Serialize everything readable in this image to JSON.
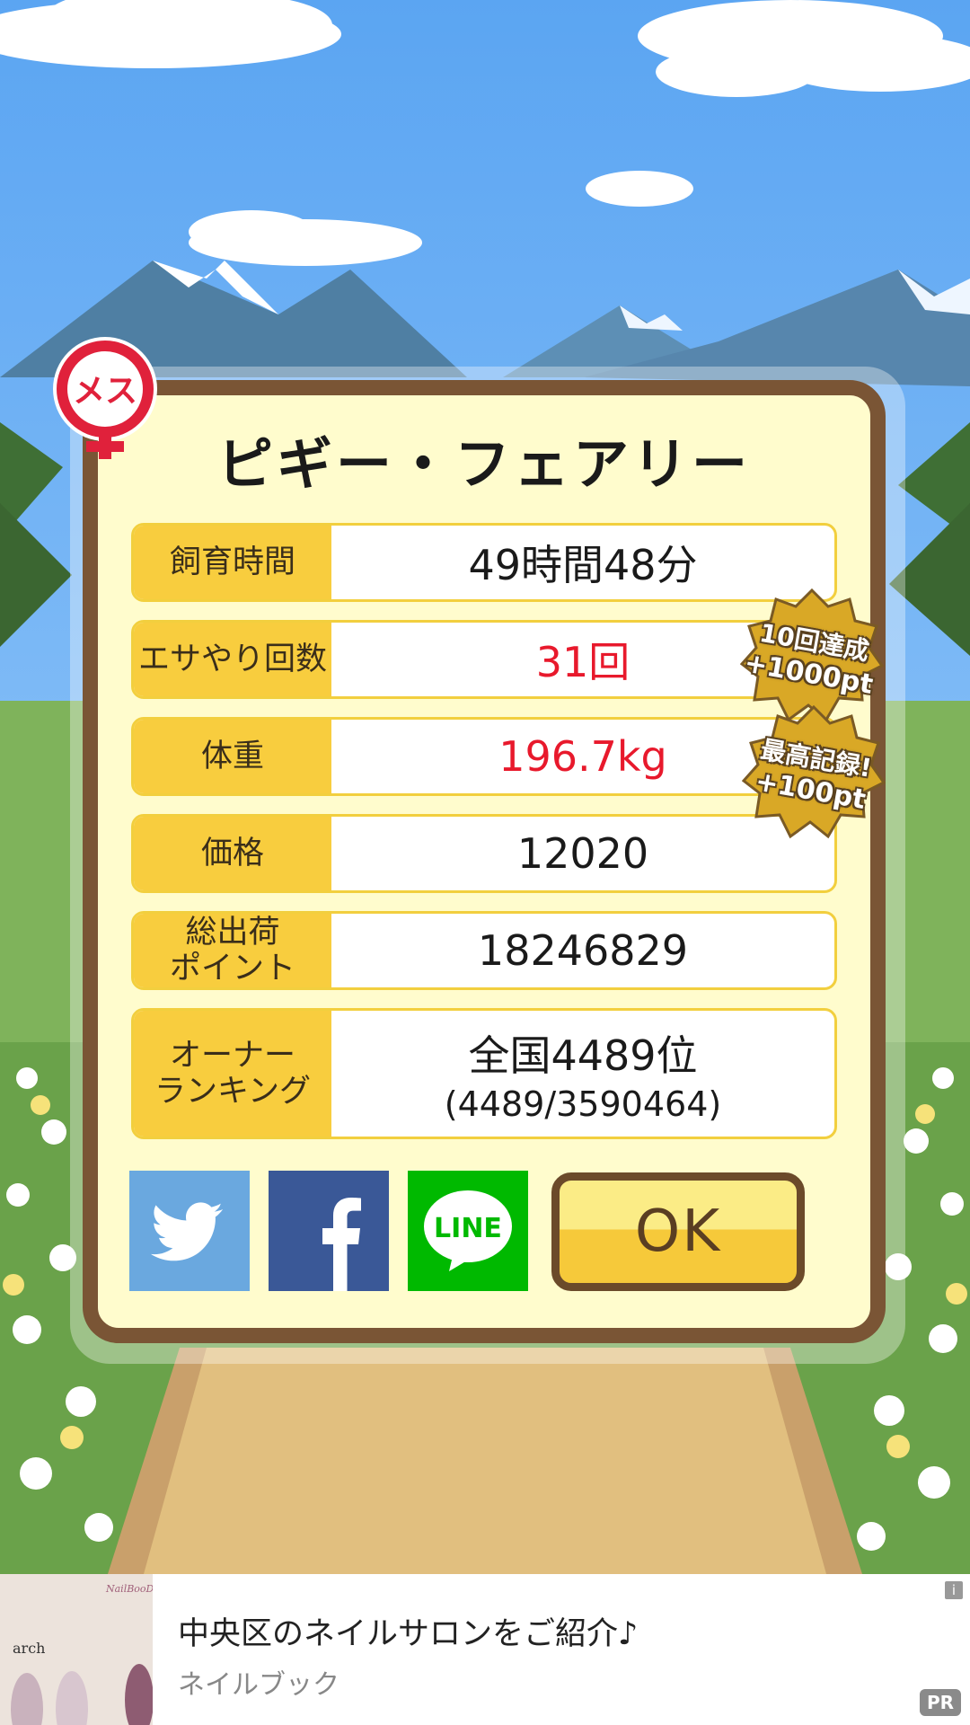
{
  "pig": {
    "name": "ピギー・フェアリー",
    "gender_label": "メス"
  },
  "stats": [
    {
      "label": "飼育時間",
      "value": "49時間48分"
    },
    {
      "label": "エサやり回数",
      "value": "31回",
      "highlight": true
    },
    {
      "label": "体重",
      "value": "196.7kg",
      "highlight": true
    },
    {
      "label": "価格",
      "value": "12020"
    },
    {
      "label_lines": [
        "総出荷",
        "ポイント"
      ],
      "value": "18246829"
    },
    {
      "label_lines": [
        "オーナー",
        "ランキング"
      ],
      "value": "全国4489位",
      "sub_value": "(4489/3590464)"
    }
  ],
  "bonuses": [
    {
      "line1": "10回達成",
      "line2": "+1000pt"
    },
    {
      "line1": "最高記録!",
      "line2": "+100pt"
    }
  ],
  "share": {
    "twitter": {
      "icon": "twitter-bird-icon",
      "color": "#6aa8df"
    },
    "facebook": {
      "icon": "facebook-f-icon",
      "color": "#3a5897"
    },
    "line": {
      "icon": "line-bubble-icon",
      "label": "LINE",
      "color": "#00b900"
    }
  },
  "ok_label": "OK",
  "ad": {
    "title": "中央区のネイルサロンをご紹介♪",
    "source": "ネイルブック",
    "badge": "PR",
    "info": "i",
    "thumb_brand": "arch",
    "thumb_logo": "NailBooD"
  },
  "colors": {
    "label_bg": "#f8cd3e",
    "highlight_text": "#e8192c",
    "frame": "#7a5535",
    "panel": "#fffccd",
    "sky": "#6fb0f3"
  }
}
